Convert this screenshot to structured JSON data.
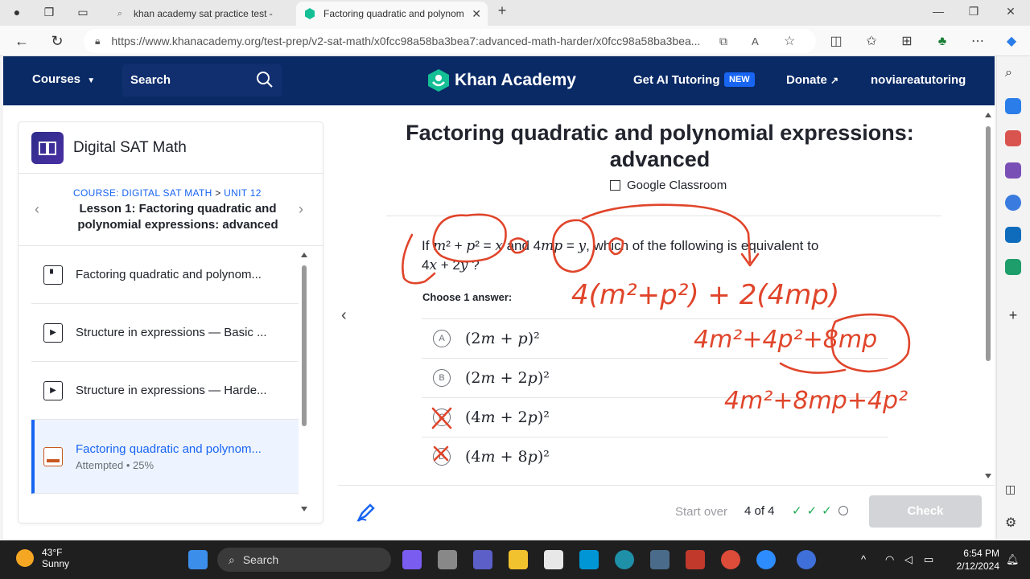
{
  "browser": {
    "tabs": [
      {
        "title": "khan academy sat practice test -",
        "active": false
      },
      {
        "title": "Factoring quadratic and polynom",
        "active": true
      }
    ],
    "url": "https://www.khanacademy.org/test-prep/v2-sat-math/x0fcc98a58ba3bea7:advanced-math-harder/x0fcc98a58ba3bea..."
  },
  "header": {
    "courses_label": "Courses",
    "search_label": "Search",
    "logo_text": "Khan Academy",
    "ai_tutoring": "Get AI Tutoring",
    "new_badge": "NEW",
    "donate": "Donate",
    "username": "noviareatutoring"
  },
  "sidebar": {
    "course_title": "Digital SAT Math",
    "crumb_course": "COURSE: DIGITAL SAT MATH",
    "crumb_sep": ">",
    "crumb_unit": "UNIT 12",
    "lesson_title": "Lesson 1: Factoring quadratic and polynomial expressions: advanced",
    "items": [
      {
        "label": "Factoring quadratic and polynom...",
        "icon": "article-icon"
      },
      {
        "label": "Structure in expressions — Basic ...",
        "icon": "play-icon"
      },
      {
        "label": "Structure in expressions — Harde...",
        "icon": "play-icon"
      },
      {
        "label": "Factoring quadratic and polynom...",
        "icon": "exercise-icon",
        "status": "Attempted • 25%"
      }
    ]
  },
  "question": {
    "title": "Factoring quadratic and polynomial expressions: advanced",
    "classroom": "Google Classroom",
    "choose": "Choose 1 answer:",
    "choices": [
      {
        "letter": "A"
      },
      {
        "letter": "B"
      },
      {
        "letter": "C"
      },
      {
        "letter": "D"
      }
    ]
  },
  "footer": {
    "start_over": "Start over",
    "progress": "4 of 4",
    "check": "Check"
  },
  "taskbar": {
    "temp": "43°F",
    "condition": "Sunny",
    "search": "Search",
    "time": "6:54 PM",
    "date": "2/12/2024"
  },
  "colors": {
    "ka_navy": "#0a2a66",
    "ka_blue": "#1865f2",
    "ka_green": "#14bf96",
    "ink_red": "#e0452b",
    "correct_green": "#1fab54"
  }
}
